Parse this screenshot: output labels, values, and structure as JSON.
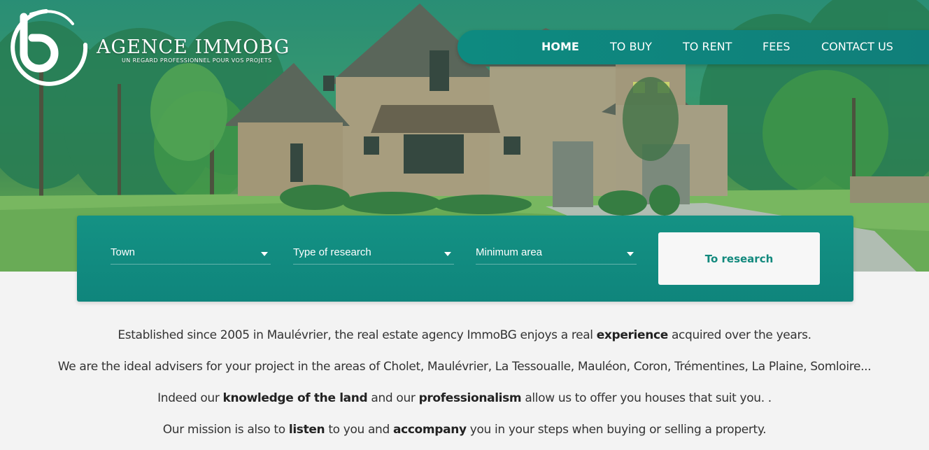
{
  "brand": {
    "name": "AGENCE IMMOBG",
    "tagline": "UN REGARD PROFESSIONNEL POUR VOS PROJETS"
  },
  "nav": {
    "items": [
      {
        "label": "HOME",
        "active": true
      },
      {
        "label": "TO BUY",
        "active": false
      },
      {
        "label": "TO RENT",
        "active": false
      },
      {
        "label": "FEES",
        "active": false
      },
      {
        "label": "CONTACT US",
        "active": false
      }
    ]
  },
  "search": {
    "town_label": "Town",
    "type_label": "Type of research",
    "area_label": "Minimum area",
    "submit_label": "To research"
  },
  "intro": {
    "line1": {
      "pre": "Established since 2005 in Maulévrier, the real estate agency ImmoBG enjoys a real ",
      "bold": "experience",
      "post": " acquired over the years."
    },
    "line2": {
      "text": "We are the ideal advisers for your project in the areas of Cholet, Maulévrier, La Tessoualle, Mauléon, Coron, Trémentines, La Plaine, Somloire..."
    },
    "line3": {
      "pre": "Indeed our ",
      "bold1": "knowledge of the land",
      "mid": " and our ",
      "bold2": "professionalism",
      "post": " allow us to offer you houses that suit you. ."
    },
    "line4": {
      "pre": "Our mission is also to ",
      "bold1": "listen",
      "mid": " to you and ",
      "bold2": "accompany",
      "post": " you in your steps when buying or selling a property."
    }
  },
  "colors": {
    "accent": "#0f857c",
    "button_text": "#12897d",
    "page_background": "#f3f3f3",
    "body_text": "#333333"
  },
  "icons": {
    "logo": "b-swirl-logo-mark",
    "select_caret": "caret-down-icon"
  }
}
